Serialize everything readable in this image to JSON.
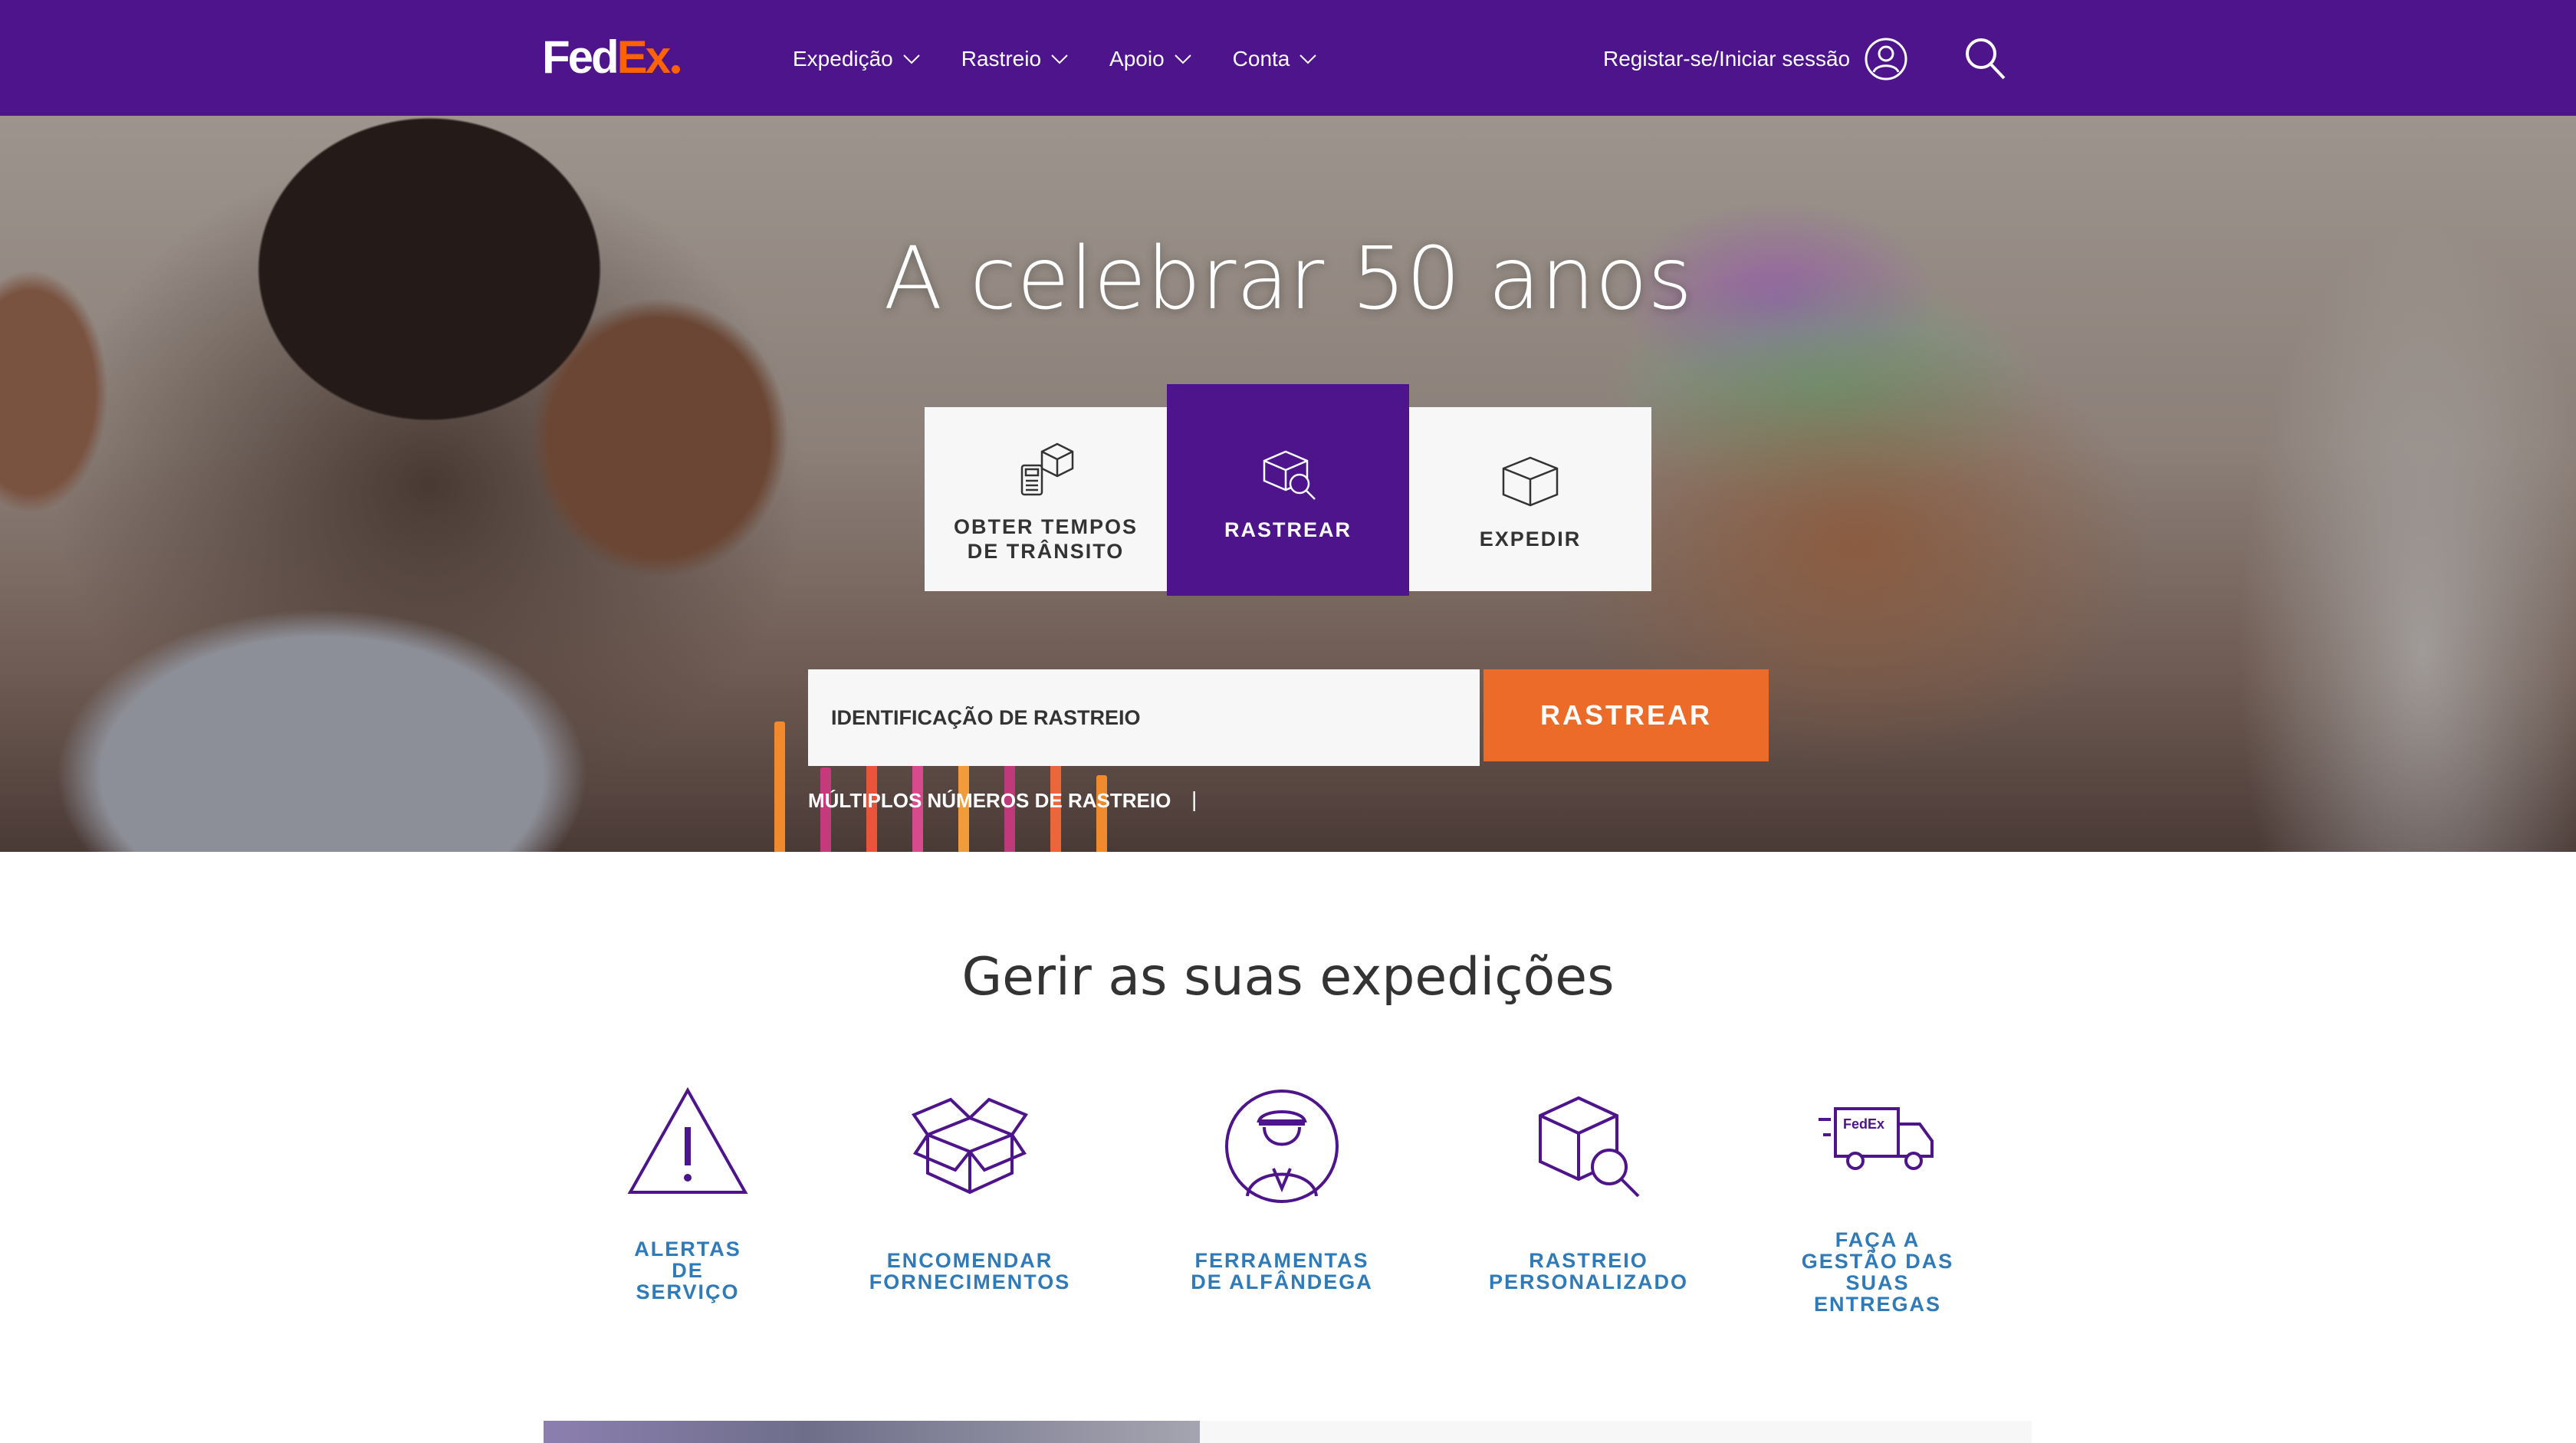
{
  "header": {
    "logo_fed": "Fed",
    "logo_ex": "Ex",
    "nav": [
      {
        "label": "Expedição",
        "icon": "chevron-down-icon"
      },
      {
        "label": "Rastreio",
        "icon": "chevron-down-icon"
      },
      {
        "label": "Apoio",
        "icon": "chevron-down-icon"
      },
      {
        "label": "Conta",
        "icon": "chevron-down-icon"
      }
    ],
    "signin_label": "Registar-se/Iniciar sessão",
    "signin_icon": "user-icon",
    "search_icon": "search-icon"
  },
  "hero": {
    "title": "A celebrar 50 anos",
    "tabs": [
      {
        "label_line1": "OBTER TEMPOS",
        "label_line2": "DE TRÂNSITO",
        "icon": "transit-time-icon",
        "active": false
      },
      {
        "label_line1": "RASTREAR",
        "label_line2": "",
        "icon": "track-package-icon",
        "active": true
      },
      {
        "label_line1": "EXPEDIR",
        "label_line2": "",
        "icon": "ship-box-icon",
        "active": false
      }
    ],
    "tracking_placeholder": "IDENTIFICAÇÃO DE RASTREIO",
    "tracking_value": "",
    "track_button": "RASTREAR",
    "multi_link": "MÚLTIPLOS NÚMEROS DE RASTREIO",
    "multi_separator": "|"
  },
  "manage": {
    "title": "Gerir as suas expedições",
    "tiles": [
      {
        "lines": [
          "ALERTAS",
          "DE",
          "SERVIÇO"
        ],
        "icon": "alert-triangle-icon"
      },
      {
        "lines": [
          "ENCOMENDAR",
          "FORNECIMENTOS"
        ],
        "icon": "open-box-icon"
      },
      {
        "lines": [
          "FERRAMENTAS",
          "DE ALFÂNDEGA"
        ],
        "icon": "customs-officer-icon"
      },
      {
        "lines": [
          "RASTREIO",
          "PERSONALIZADO"
        ],
        "icon": "package-search-icon"
      },
      {
        "lines": [
          "FAÇA A",
          "GESTÃO DAS",
          "SUAS",
          "ENTREGAS"
        ],
        "icon": "delivery-truck-icon"
      }
    ]
  },
  "colors": {
    "brand_purple": "#4d148c",
    "brand_orange": "#ff6200",
    "track_button": "#ed6b29",
    "tile_label_blue": "#2f7ab8"
  }
}
